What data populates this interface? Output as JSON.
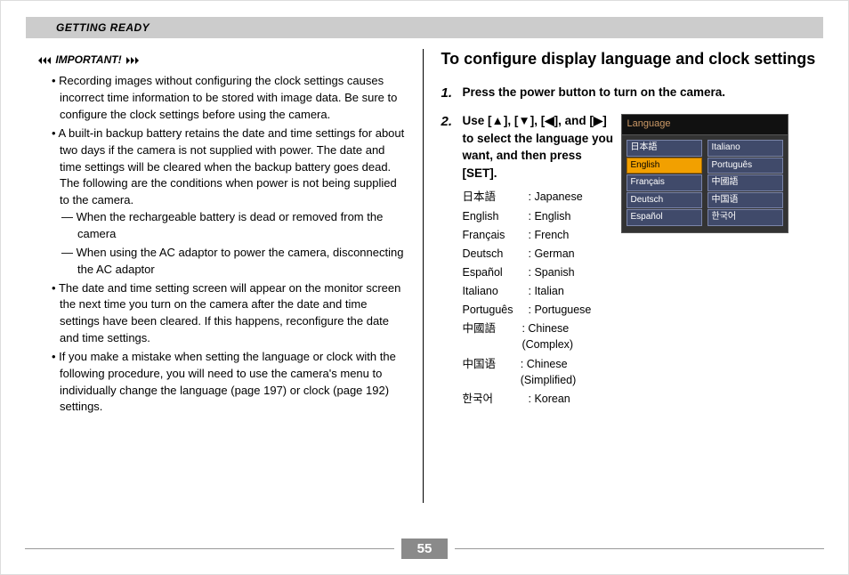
{
  "header": {
    "title": "GETTING READY"
  },
  "left": {
    "important_label": "IMPORTANT!",
    "bullets": [
      "Recording images without configuring the clock settings causes incorrect time information to be stored with image data. Be sure to configure the clock settings before using the camera.",
      "A built-in backup battery retains the date and time settings for about two days if the camera is not supplied with power. The date and time settings will be cleared when the backup battery goes dead. The following are the conditions when power is not being supplied to the camera.",
      "The date and time setting screen will appear on the monitor screen the next time you turn on the camera after the date and time settings have been cleared. If this happens, reconfigure the date and time settings.",
      "If you make a mistake when setting the language or clock with the  following procedure, you will need to use the camera's menu to individually change the language (page 197) or clock (page 192) settings."
    ],
    "sub_bullets": [
      "When the rechargeable battery is dead or removed from the camera",
      "When using the AC adaptor to power the camera, disconnecting the AC adaptor"
    ]
  },
  "right": {
    "heading": "To configure display language and clock settings",
    "step1_num": "1.",
    "step1_text": "Press the power button to turn on the camera.",
    "step2_num": "2.",
    "step2_text": "Use [▲], [▼], [◀], and [▶] to select the language you want, and then press [SET].",
    "languages": [
      {
        "native": "日本語",
        "en": ": Japanese"
      },
      {
        "native": "English",
        "en": ": English"
      },
      {
        "native": "Français",
        "en": ": French"
      },
      {
        "native": "Deutsch",
        "en": ": German"
      },
      {
        "native": "Español",
        "en": ": Spanish"
      },
      {
        "native": "Italiano",
        "en": ": Italian"
      },
      {
        "native": "Português",
        "en": ": Portuguese"
      },
      {
        "native": "中國語",
        "en": ": Chinese (Complex)"
      },
      {
        "native": "中国语",
        "en": ": Chinese (Simplified)"
      },
      {
        "native": "한국어",
        "en": ": Korean"
      }
    ],
    "menu": {
      "title": "Language",
      "left_col": [
        "日本語",
        "English",
        "Français",
        "Deutsch",
        "Español"
      ],
      "right_col": [
        "Italiano",
        "Português",
        "中國語",
        "中国语",
        "한국어"
      ],
      "selected": "English"
    }
  },
  "page_number": "55"
}
